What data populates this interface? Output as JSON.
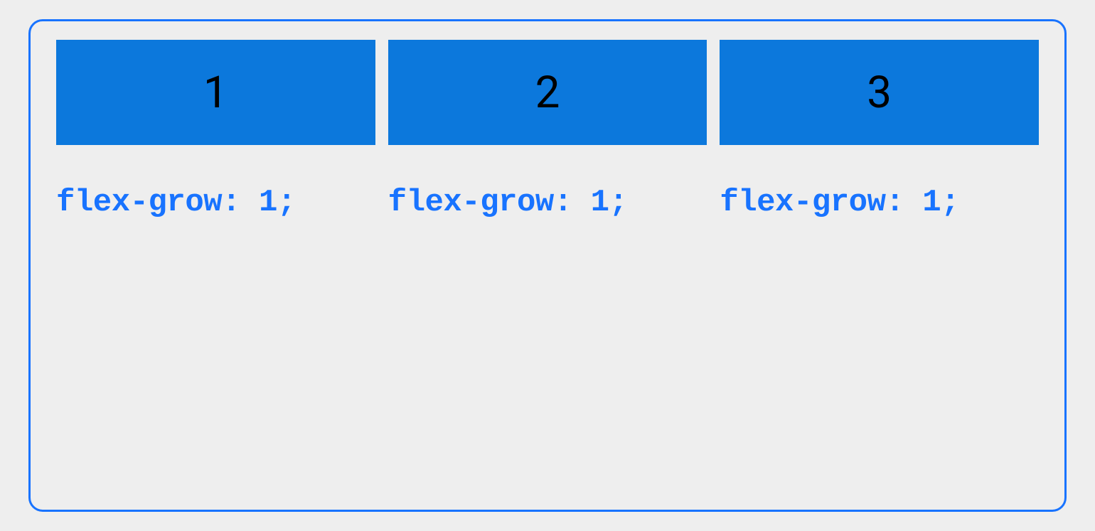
{
  "colors": {
    "page_bg": "#eeeeee",
    "border": "#1873ff",
    "box_bg": "#0c78dc",
    "box_text": "#000000",
    "label_text": "#1873ff"
  },
  "boxes": [
    {
      "number": "1",
      "css": "flex-grow: 1;"
    },
    {
      "number": "2",
      "css": "flex-grow: 1;"
    },
    {
      "number": "3",
      "css": "flex-grow: 1;"
    }
  ]
}
